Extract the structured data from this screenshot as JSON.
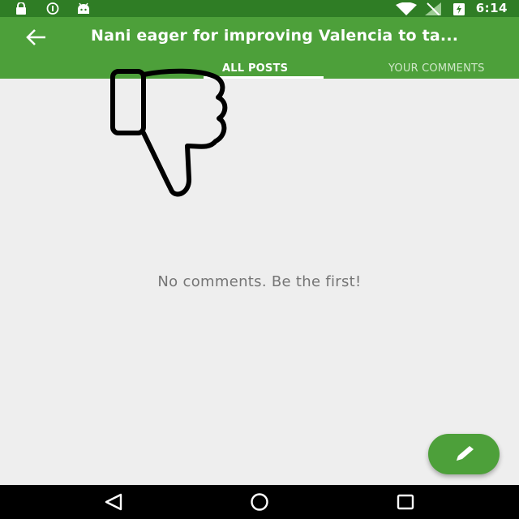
{
  "status_bar": {
    "time": "6:14",
    "icons": [
      "lock-icon",
      "info-icon",
      "android-icon",
      "wifi-icon",
      "signal-icon",
      "battery-charging-icon"
    ]
  },
  "app_bar": {
    "title": "Nani eager for improving Valencia to ta...",
    "back_icon": "arrow-left-icon"
  },
  "tabs": [
    {
      "label": "ALL POSTS",
      "selected": true
    },
    {
      "label": "YOUR COMMENTS",
      "selected": false
    }
  ],
  "content": {
    "empty_message": "No comments. Be the first!",
    "overlay_icon": "thumbs-down-icon"
  },
  "fab": {
    "icon": "pencil-icon"
  },
  "nav_bar": {
    "icons": [
      "back-triangle-icon",
      "home-circle-icon",
      "recents-square-icon"
    ]
  },
  "colors": {
    "status_bar": "#2f7d25",
    "app_bar": "#4da03a",
    "background": "#eeeeee",
    "message_text": "#757575",
    "fab": "#4da03a"
  }
}
